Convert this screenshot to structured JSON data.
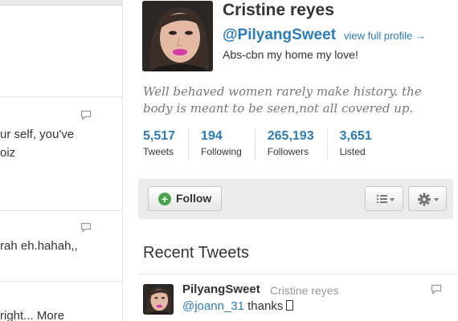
{
  "timeline": {
    "tweets": [
      {
        "text": "ur self, you've",
        "text2": "oiz"
      },
      {
        "text": "rah eh.hahah,,"
      },
      {
        "text_before": "right... ",
        "more_label": "More"
      }
    ]
  },
  "profile": {
    "name": "Cristine reyes",
    "handle": "@PilyangSweet",
    "view_profile_label": "view full profile →",
    "location": "Abs-cbn my home my love!",
    "bio": "Well behaved women rarely make history. the body is meant to be seen,not all covered up.",
    "stats": [
      {
        "value": "5,517",
        "label": "Tweets"
      },
      {
        "value": "194",
        "label": "Following"
      },
      {
        "value": "265,193",
        "label": "Followers"
      },
      {
        "value": "3,651",
        "label": "Listed"
      }
    ]
  },
  "actions": {
    "follow_label": "Follow"
  },
  "recent": {
    "title": "Recent Tweets",
    "tweet": {
      "username": "PilyangSweet",
      "fullname": "Cristine reyes",
      "mention": "@joann_31",
      "text": " thanks"
    }
  },
  "colors": {
    "link": "#2b7bb9",
    "follow_icon": "#4aa34a",
    "action_bar": "#ebebeb"
  }
}
